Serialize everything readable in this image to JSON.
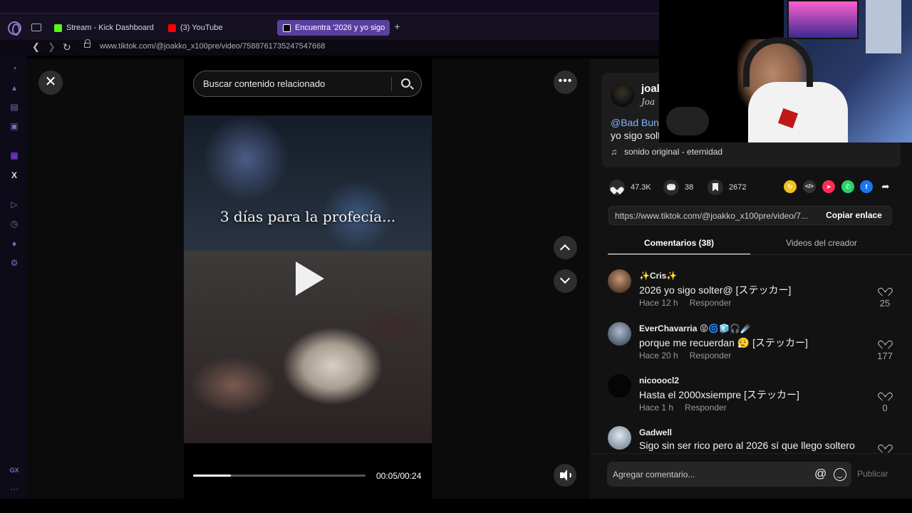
{
  "browser": {
    "tabs": [
      {
        "label": "Stream - Kick Dashboard",
        "favicon": "kick-icon"
      },
      {
        "label": "(3) YouTube",
        "favicon": "youtube-icon"
      },
      {
        "label": "Encuentra '2026 y yo sigo",
        "favicon": "tiktok-icon",
        "active": true
      }
    ],
    "new_tab_label": "+",
    "url": "www.tiktok.com/@joakko_x100pre/video/7588761735247547668"
  },
  "sidebar": {
    "items": [
      "speed-dial-icon",
      "shop-icon",
      "news-icon",
      "messenger-icon",
      "twitch-icon",
      "x-icon",
      "player-icon",
      "history-icon",
      "extensions-icon",
      "settings-icon",
      "gx-icon",
      "more-icon"
    ],
    "gx_label": "GX",
    "more_label": "···"
  },
  "viewer": {
    "close_label": "✕",
    "more_label": "•••",
    "search_placeholder": "Buscar contenido relacionado",
    "video_caption": "3 días para la profecía...",
    "progress": 0.22,
    "time": "00:05/00:24"
  },
  "post": {
    "author_name": "joalk",
    "author_nick": "Joa",
    "mention": "@Bad Bunn",
    "description": "yo sigo solt",
    "music_icon": "♫",
    "music": "sonido original - eternidad",
    "likes": "47.3K",
    "comments": "38",
    "bookmarks": "2672",
    "share_icons": [
      "repost-icon",
      "embed-icon",
      "send-icon",
      "whatsapp-icon",
      "facebook-icon",
      "share-arrow-icon"
    ],
    "link": "https://www.tiktok.com/@joakko_x100pre/video/7...",
    "copy_label": "Copiar enlace"
  },
  "tabs": {
    "comments": "Comentarios (38)",
    "videos": "Videos del creador"
  },
  "comments": [
    {
      "user": "✨Cris✨",
      "text": "2026 yo sigo solter@ [ステッカー]",
      "time": "Hace 12 h",
      "reply": "Responder",
      "likes": "25",
      "avatar_color": "#6a5040"
    },
    {
      "user": "EverChavarria 😝🌀🧊🎧☄️",
      "text": "porque me recuerdan 😮‍💨 [ステッカー]",
      "time": "Hace 20 h",
      "reply": "Responder",
      "likes": "177",
      "avatar_color": "#8fa0b8"
    },
    {
      "user": "nicooocl2",
      "text": "Hasta el 2000xsiempre [ステッカー]",
      "time": "Hace 1 h",
      "reply": "Responder",
      "likes": "0",
      "avatar_color": "#0a0a0a"
    },
    {
      "user": "Gadwell",
      "text": "Sigo sin ser rico pero al 2026 sí que llego soltero",
      "time": "",
      "reply": "",
      "likes": "",
      "avatar_color": "#c8d0d8"
    }
  ],
  "comment_box": {
    "placeholder": "Agregar comentario...",
    "at_label": "@",
    "publish_label": "Publicar"
  },
  "colors": {
    "accent": "#5a3fa0",
    "link": "#7fb5ff",
    "panel_bg": "#121212"
  }
}
